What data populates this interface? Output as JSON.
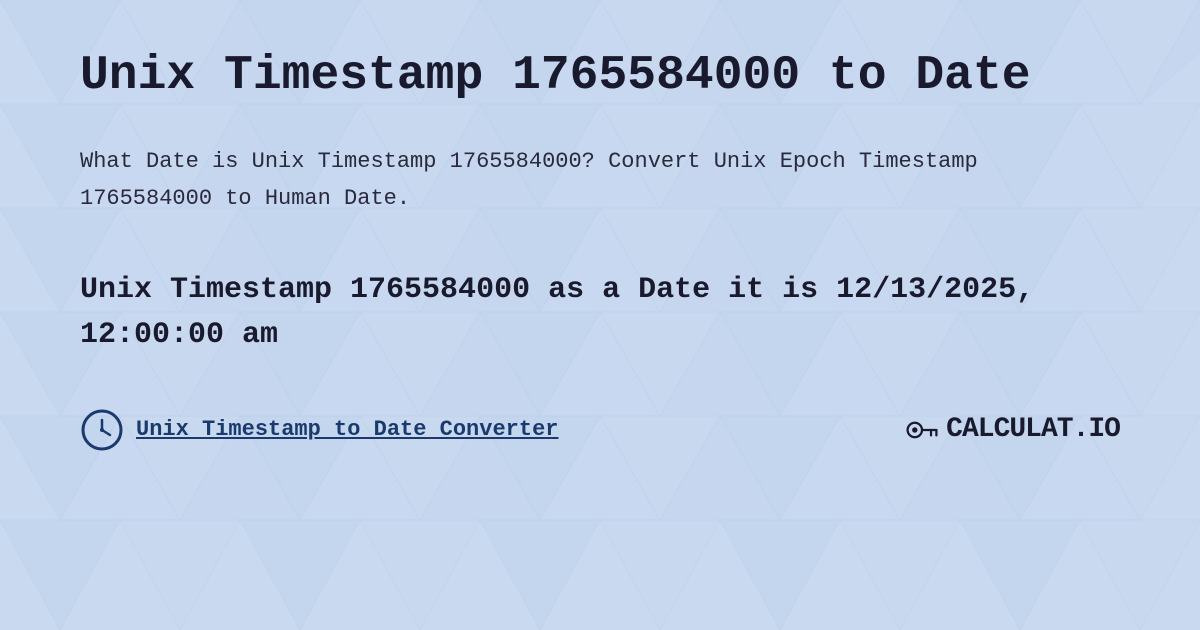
{
  "page": {
    "title": "Unix Timestamp 1765584000 to Date",
    "description": "What Date is Unix Timestamp 1765584000? Convert Unix Epoch Timestamp 1765584000 to Human Date.",
    "result": "Unix Timestamp 1765584000 as a Date it is 12/13/2025, 12:00:00 am",
    "footer_link": "Unix Timestamp to Date Converter",
    "logo": "CALCULAT.IO",
    "background_color": "#c8d8f0"
  }
}
